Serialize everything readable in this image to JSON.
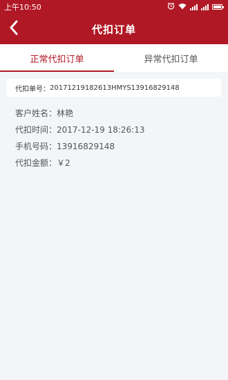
{
  "status_bar": {
    "time": "上午10:50",
    "icons": [
      "alarm-icon",
      "wifi-icon",
      "signal-icon",
      "signal-icon",
      "battery-icon"
    ]
  },
  "header": {
    "title": "代扣订单",
    "back_icon": "chevron-left-icon"
  },
  "tabs": [
    {
      "label": "正常代扣订单",
      "active": true
    },
    {
      "label": "异常代扣订单",
      "active": false
    }
  ],
  "order": {
    "number_label": "代扣单号：",
    "number_value": "20171219182613HMYS13916829148",
    "fields": [
      {
        "label": "客户姓名：",
        "value": "林艳"
      },
      {
        "label": "代扣时间：",
        "value": "2017-12-19 18:26:13"
      },
      {
        "label": "手机号码：",
        "value": "13916829148"
      },
      {
        "label": "代扣金额：",
        "value": "￥2"
      }
    ]
  },
  "colors": {
    "brand": "#b11825",
    "background": "#f3f5f9"
  }
}
